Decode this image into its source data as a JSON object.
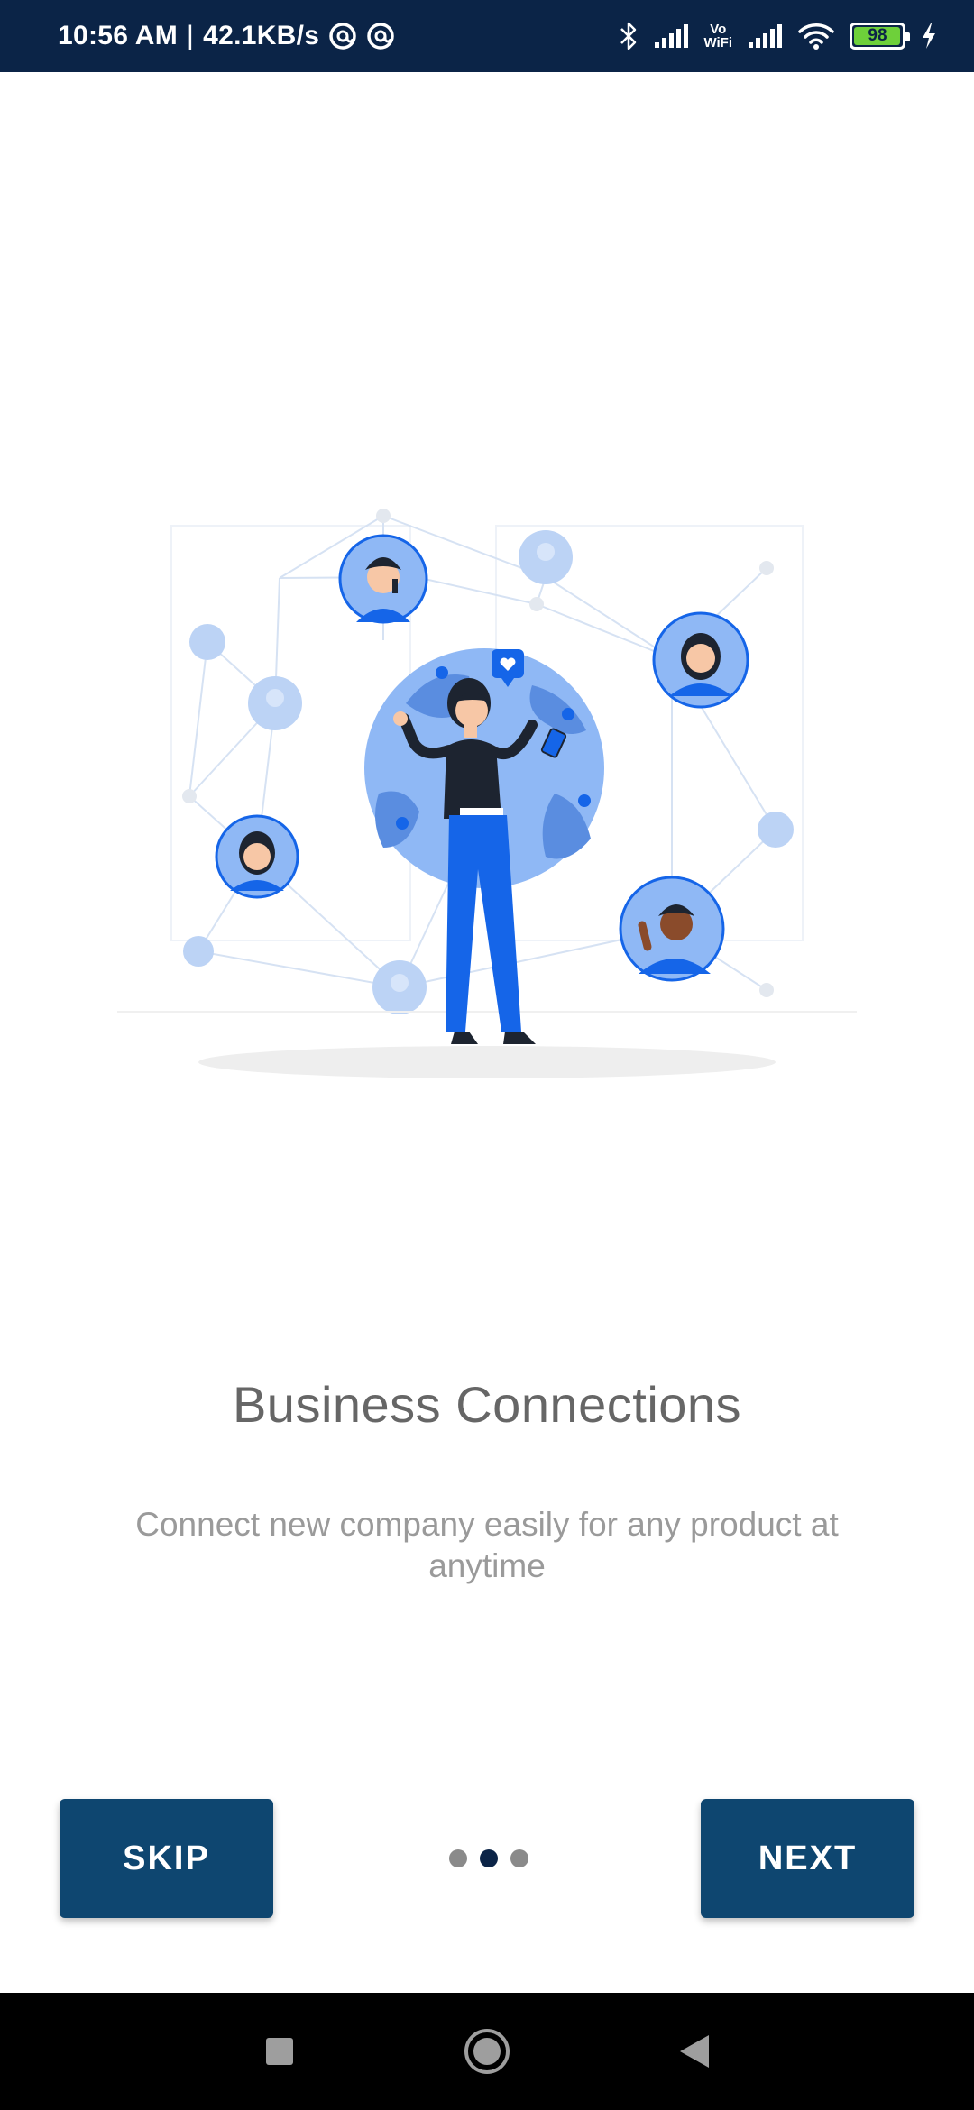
{
  "status_bar": {
    "time": "10:56 AM",
    "separator": "|",
    "speed": "42.1KB/s",
    "vowifi_top": "Vo",
    "vowifi_bottom": "WiFi",
    "battery": "98",
    "battery_level": 0.98,
    "icons": [
      "at-sign-icon",
      "at-sign-icon",
      "bluetooth-icon",
      "signal-icon",
      "vowifi-icon",
      "signal-icon",
      "wifi-icon",
      "battery-icon",
      "charging-icon"
    ]
  },
  "onboarding": {
    "illustration": "business-network-illustration",
    "title": "Business Connections",
    "subtitle": "Connect new company easily for any product at anytime",
    "page_indicator": {
      "total": 3,
      "current": 2
    }
  },
  "buttons": {
    "skip": "SKIP",
    "next": "NEXT"
  },
  "nav_bar": {
    "icons": [
      "recents-square-icon",
      "home-circle-icon",
      "back-triangle-icon"
    ]
  },
  "colors": {
    "status_bar": "#0b2447",
    "button": "#0e4670",
    "accent_blue": "#1565e8",
    "globe": "#8fb8f5"
  }
}
